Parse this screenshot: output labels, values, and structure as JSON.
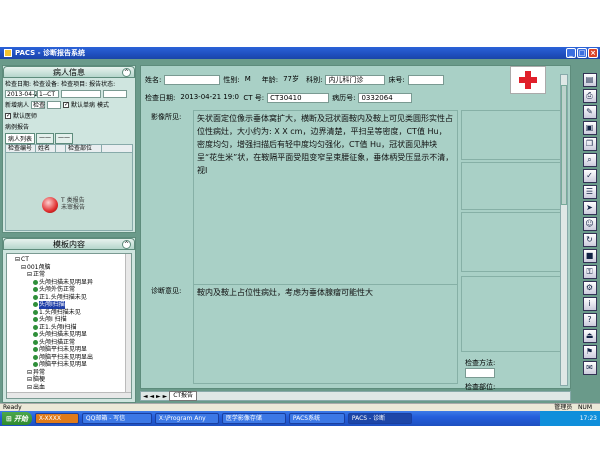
{
  "window": {
    "title": "PACS - 诊断报告系统"
  },
  "patient_panel": {
    "title": "病人信息",
    "search_date_label": "检查日期:",
    "search_device_label": "检查设备:",
    "search_item_label": "检查项目:",
    "search_type_label": "报告状态:",
    "date_value": "2013-04-21",
    "device_value": "1--CT",
    "new_label": "新增病人",
    "study_label": "检查",
    "default_check": "默认单病",
    "mode_label": "模式",
    "default_pacs": "默认医师",
    "spec_label": "病例报告",
    "tab_all": "病人列表",
    "tab2": "——",
    "tab3": "——",
    "col_checkno": "检查编号",
    "col_name": "姓名",
    "col_checkpart": "检查部位",
    "orb_text1": "T 类报告",
    "orb_text2": "未审报告"
  },
  "template_panel": {
    "title": "模板内容",
    "items": [
      {
        "label": "CT",
        "level": 1
      },
      {
        "label": "001颅脑",
        "level": 2
      },
      {
        "label": "正常",
        "level": 3
      },
      {
        "label": "头颅扫描未见明显异",
        "level": 4
      },
      {
        "label": "头颅外伤正常",
        "level": 4
      },
      {
        "label": "正1.头颅扫描未见",
        "level": 4
      },
      {
        "label": "头颅I扫描",
        "level": 4,
        "selected": true
      },
      {
        "label": "1.头颅扫描未见",
        "level": 4
      },
      {
        "label": "头颅I 扫描",
        "level": 4
      },
      {
        "label": "正1.头颅I扫描",
        "level": 4
      },
      {
        "label": "头颅扫描未见明显",
        "level": 4
      },
      {
        "label": "头颅扫描正常",
        "level": 4
      },
      {
        "label": "颅脑平扫未见明显",
        "level": 4
      },
      {
        "label": "颅脑平扫未见明显出",
        "level": 4
      },
      {
        "label": "颅脑平扫未见明显",
        "level": 4
      },
      {
        "label": "异常",
        "level": 3
      },
      {
        "label": "脑梗",
        "level": 3
      },
      {
        "label": "出血",
        "level": 3
      }
    ]
  },
  "report": {
    "name_label": "姓名:",
    "name_value": "",
    "sex_label": "性别:",
    "sex_value": "M",
    "age_label": "年龄:",
    "age_value": "77岁",
    "dept_label": "科别:",
    "dept_value": "内儿科门诊",
    "bed_label": "床号:",
    "bed_value": "",
    "date_label": "检查日期:",
    "date_value": "2013-04-21 19:0",
    "ct_label": "CT 号:",
    "ct_value": "CT30410",
    "case_label": "病历号:",
    "case_value": "0332064",
    "findings_label": "影像所见:",
    "findings_text": "矢状面定位像示垂体窝扩大，横断及冠状面鞍内及鞍上可见类圆形实性占位性病灶，大小约为: X X cm，边界清楚，平扫呈等密度，CT值 Hu，密度均匀，增强扫描后有轻中度均匀强化，CT值 Hu，冠状面见肿块呈“花生米”状，在鞍隔平面受阻变窄呈束腰征象，垂体柄受压显示不清，视I",
    "opinion_label": "诊断意见:",
    "opinion_text": "鞍内及鞍上占位性病灶，考虑为垂体腺瘤可能性大",
    "method_label": "检查方法:",
    "part_label": "检查部位:",
    "tab_label": "CT报告"
  },
  "status": {
    "left": "Ready",
    "right1": "管理员",
    "right2": "NUM"
  },
  "taskbar": {
    "start": "开始",
    "items": [
      "X-XXXX",
      "QQ邮箱 - 写信",
      "X:\\Program Any",
      "医学影像存储",
      "PACS系统",
      "PACS - 诊断"
    ],
    "clock": "17:23"
  }
}
